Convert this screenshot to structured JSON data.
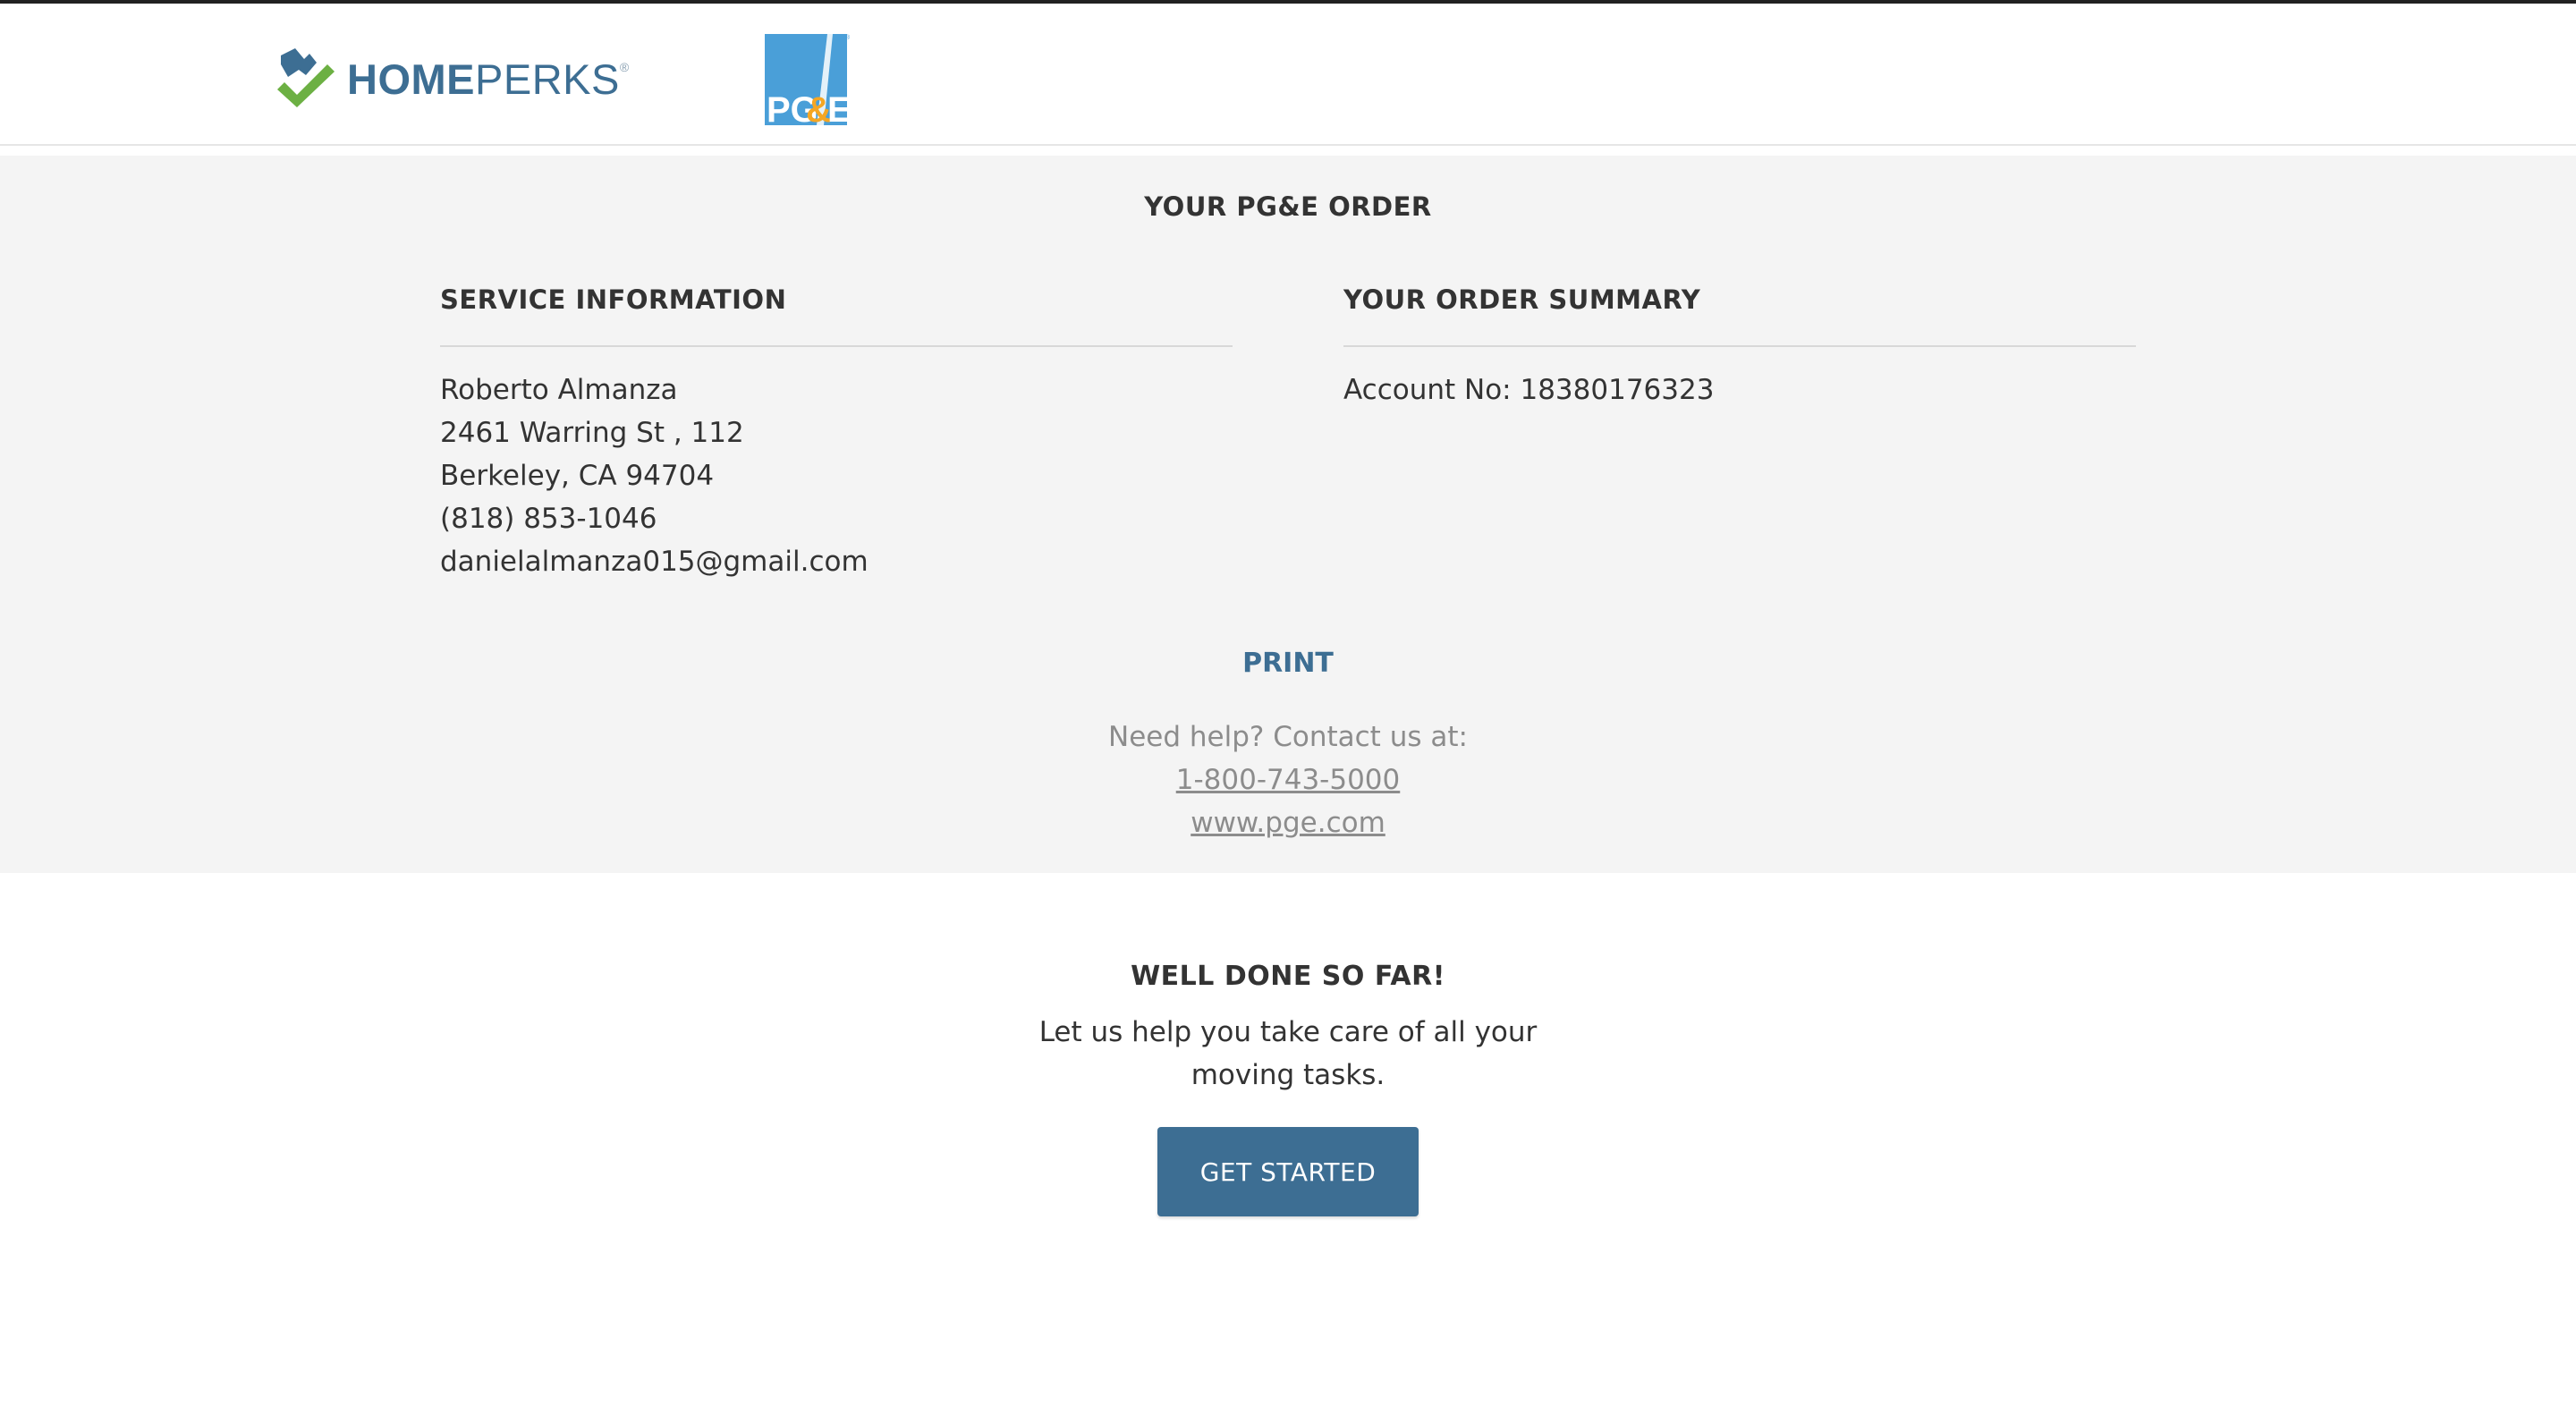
{
  "header": {
    "homeperks_logo": {
      "icon": "homeperks-checkmark-house-icon",
      "word_bold": "HOME",
      "word_light": "PERKS",
      "registered": "®"
    },
    "pge_logo": {
      "icon": "pge-logo-icon",
      "text": "PG&E"
    }
  },
  "order": {
    "title": "YOUR PG&E ORDER",
    "service_information": {
      "heading": "SERVICE INFORMATION",
      "name": "Roberto Almanza",
      "address_line1": "2461 Warring St , 112",
      "address_line2": "Berkeley, CA 94704",
      "phone": "(818) 853-1046",
      "email": "danielalmanza015@gmail.com"
    },
    "order_summary": {
      "heading": "YOUR ORDER SUMMARY",
      "account": "Account No: 18380176323"
    },
    "print_label": "PRINT",
    "help": {
      "prompt": "Need help? Contact us at:",
      "phone_link": "1-800-743-5000",
      "web_link": "www.pge.com"
    }
  },
  "promo": {
    "heading": "WELL DONE SO FAR!",
    "text": "Let us help you take care of all your moving tasks.",
    "button_label": "GET STARTED"
  },
  "colors": {
    "brand_blue": "#3d6e93",
    "band_grey": "#f4f4f4",
    "check_green": "#6cb043",
    "pge_blue": "#4a9fd8",
    "pge_orange": "#f5a623"
  }
}
